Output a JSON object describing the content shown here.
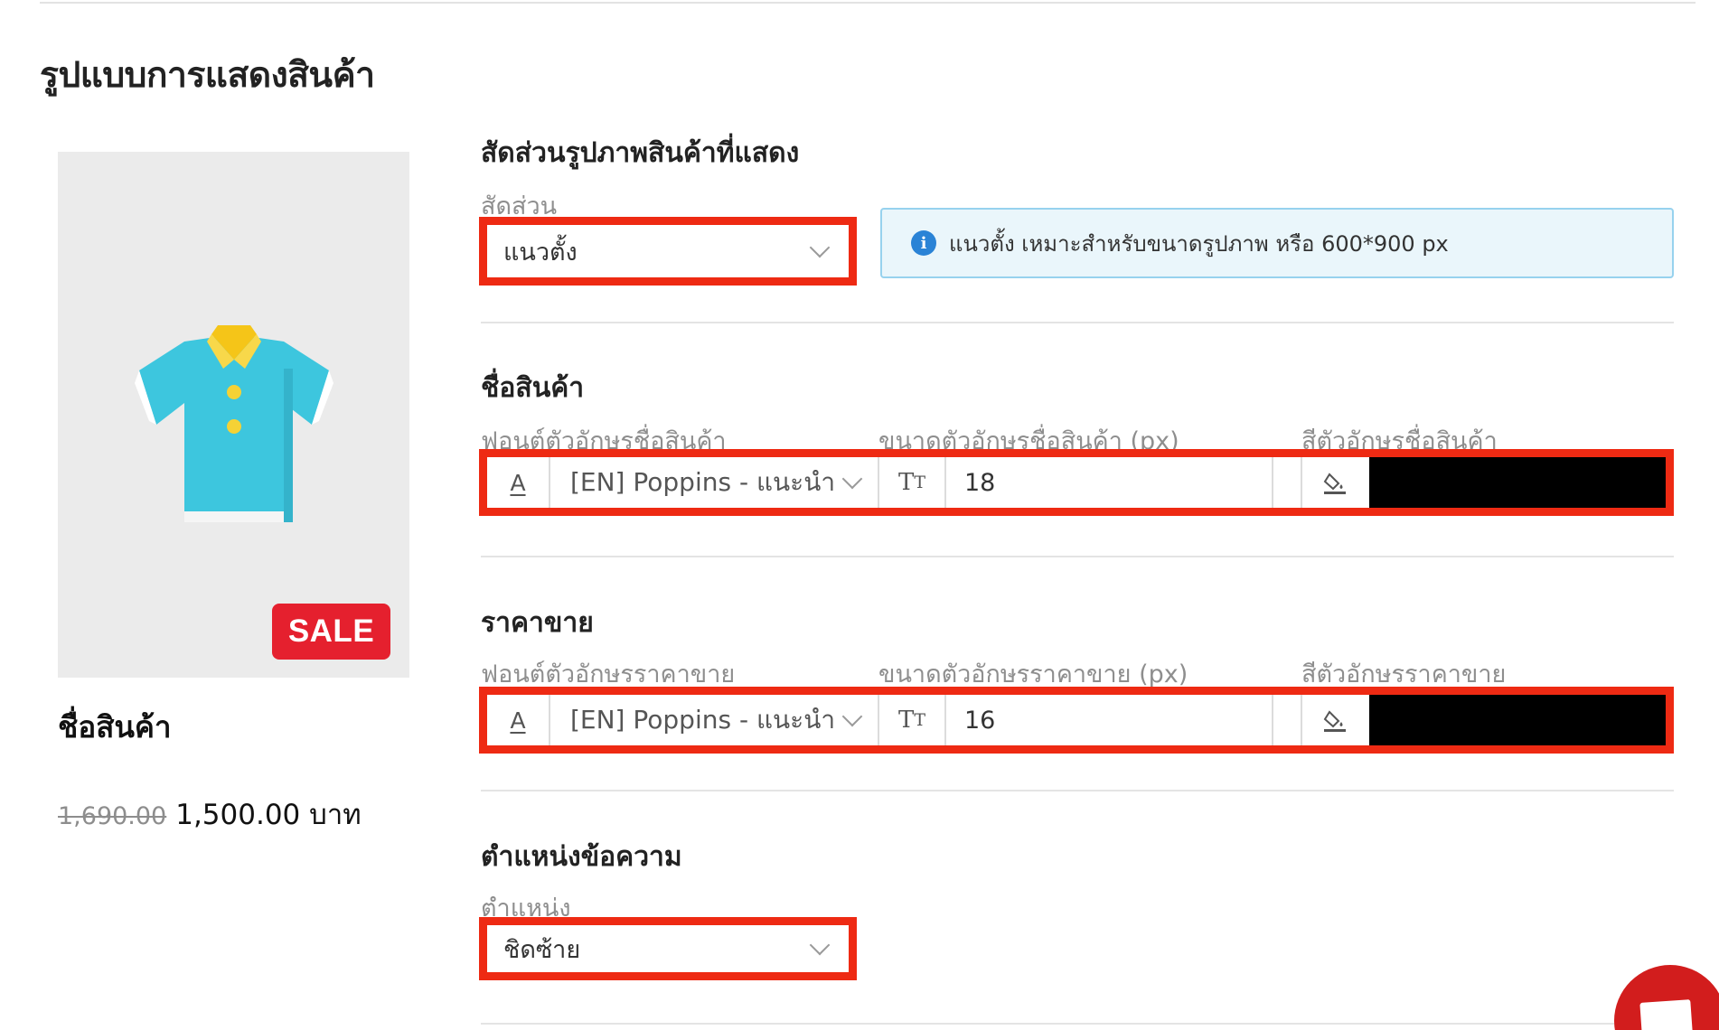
{
  "page": {
    "title": "รูปแบบการแสดงสินค้า"
  },
  "preview": {
    "sale_badge": "SALE",
    "product_name": "ชื่อสินค้า",
    "old_price": "1,690.00",
    "price": "1,500.00 บาท",
    "image_icon": "shirt-icon"
  },
  "ratio_section": {
    "title": "สัดส่วนรูปภาพสินค้าที่แสดง",
    "label": "สัดส่วน",
    "selected": "แนวตั้ง",
    "info_text": "แนวตั้ง เหมาะสำหรับขนาดรูปภาพ หรือ 600*900 px"
  },
  "name_section": {
    "title": "ชื่อสินค้า",
    "font_label": "ฟอนต์ตัวอักษรชื่อสินค้า",
    "size_label": "ขนาดตัวอักษรชื่อสินค้า (px)",
    "color_label": "สีตัวอักษรชื่อสินค้า",
    "font_value": "[EN] Poppins - แนะนำ",
    "size_value": "18",
    "color_value": "#000000"
  },
  "price_section": {
    "title": "ราคาขาย",
    "font_label": "ฟอนต์ตัวอักษรราคาขาย",
    "size_label": "ขนาดตัวอักษรราคาขาย (px)",
    "color_label": "สีตัวอักษรราคาขาย",
    "font_value": "[EN] Poppins - แนะนำ",
    "size_value": "16",
    "color_value": "#000000"
  },
  "position_section": {
    "title": "ตำแหน่งข้อความ",
    "label": "ตำแหน่ง",
    "selected": "ชิดซ้าย"
  },
  "colors": {
    "highlight": "#ee2a13",
    "sale": "#e5202e",
    "info_bg": "#eaf6fb",
    "info_icon": "#2a83d6"
  }
}
